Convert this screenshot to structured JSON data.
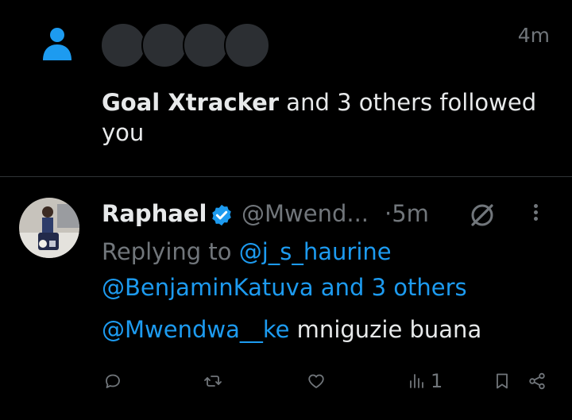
{
  "notification": {
    "time": "4m",
    "bold_name": "Goal Xtracker",
    "text": " and 3 others followed you",
    "icon": "person-icon"
  },
  "tweet": {
    "name": "Raphael",
    "handle": "@Mwend...",
    "time": "·5m",
    "reply_prefix": "Replying to ",
    "reply_to_1": "@j_s_haurine",
    "reply_to_2": "@BenjaminKatuva and 3 others",
    "body_mention": "@Mwendwa__ke",
    "body_text": " mniguzie buana",
    "views": "1"
  },
  "colors": {
    "accent": "#1d9bf0",
    "muted": "#71767b",
    "text": "#e7e9ea",
    "background": "#000000"
  }
}
